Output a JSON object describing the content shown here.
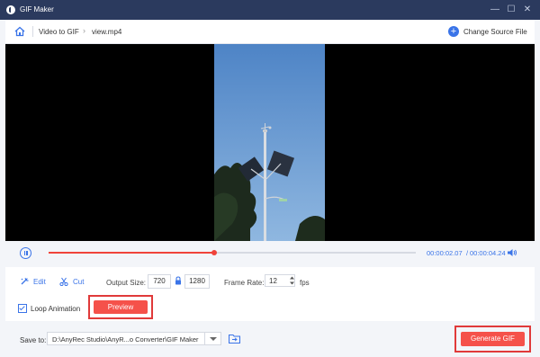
{
  "window": {
    "title": "GIF Maker",
    "controls": {
      "minimize": "—",
      "maximize": "☐",
      "close": "✕"
    }
  },
  "nav": {
    "home_icon": "home-icon",
    "breadcrumb": [
      "Video to GIF",
      "view.mp4"
    ],
    "change_source_label": "Change Source File"
  },
  "player": {
    "progress_fraction": 0.45,
    "time_current": "00:00:02.07",
    "time_separator": "/",
    "time_total": "00:00:04.24"
  },
  "controls": {
    "edit_label": "Edit",
    "cut_label": "Cut",
    "output_size_label": "Output Size:",
    "output_width": "720",
    "output_height": "1280",
    "frame_rate_label": "Frame Rate:",
    "frame_rate_value": "12",
    "fps_label": "fps",
    "loop_label": "Loop Animation",
    "loop_checked": true,
    "preview_label": "Preview"
  },
  "footer": {
    "save_to_label": "Save to:",
    "save_path": "D:\\AnyRec Studio\\AnyR...o Converter\\GIF Maker",
    "generate_label": "Generate GIF"
  },
  "colors": {
    "accent_blue": "#3a74e8",
    "accent_red": "#f5514a",
    "highlight_red": "#e03a3a",
    "titlebar": "#2b3a5e"
  }
}
